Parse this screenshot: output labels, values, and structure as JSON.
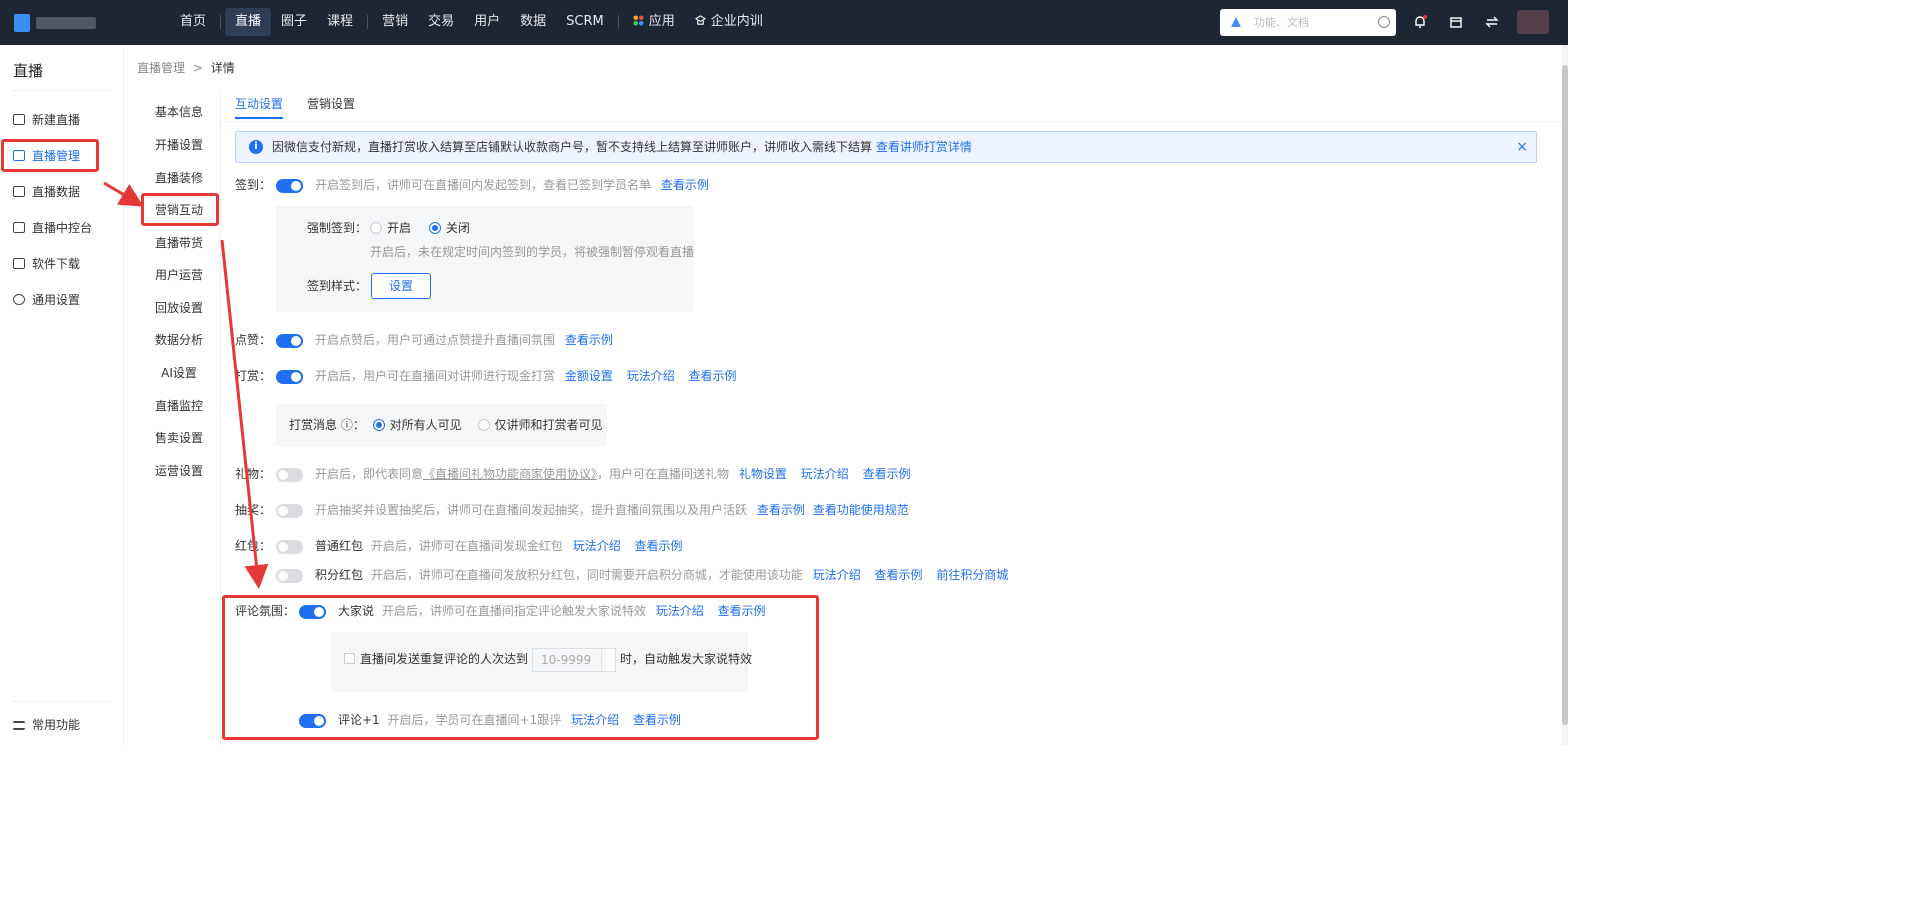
{
  "topnav": {
    "items": [
      "首页",
      "直播",
      "圈子",
      "课程",
      "营销",
      "交易",
      "用户",
      "数据",
      "SCRM",
      "应用",
      "企业内训"
    ],
    "active": "直播",
    "search_placeholder": "功能、文档"
  },
  "sidebar": {
    "title": "直播",
    "items": [
      {
        "label": "新建直播",
        "icon": "plus-box-icon"
      },
      {
        "label": "直播管理",
        "icon": "list-box-icon",
        "active": true
      },
      {
        "label": "直播数据",
        "icon": "chart-box-icon"
      },
      {
        "label": "直播中控台",
        "icon": "monitor-icon"
      },
      {
        "label": "软件下载",
        "icon": "download-icon"
      },
      {
        "label": "通用设置",
        "icon": "gear-icon"
      }
    ],
    "bottom": "常用功能"
  },
  "breadcrumb": {
    "parent": "直播管理",
    "sep": ">",
    "current": "详情"
  },
  "subnav": [
    "基本信息",
    "开播设置",
    "直播装修",
    "营销互动",
    "直播带货",
    "用户运营",
    "回放设置",
    "数据分析",
    "AI设置",
    "直播监控",
    "售卖设置",
    "运营设置"
  ],
  "tabs": [
    "互动设置",
    "营销设置"
  ],
  "notice": {
    "text": "因微信支付新规，直播打赏收入结算至店铺默认收款商户号，暂不支持线上结算至讲师账户，讲师收入需线下结算",
    "link": "查看讲师打赏详情",
    "close": "×"
  },
  "signin": {
    "label": "签到：",
    "on": true,
    "desc": "开启签到后，讲师可在直播间内发起签到，查看已签到学员名单",
    "link": "查看示例",
    "force_label": "强制签到：",
    "opt_on": "开启",
    "opt_off": "关闭",
    "force_selected": "关闭",
    "force_desc": "开启后，未在规定时间内签到的学员，将被强制暂停观看直播",
    "style_label": "签到样式：",
    "style_btn": "设置"
  },
  "like": {
    "label": "点赞：",
    "on": true,
    "desc": "开启点赞后，用户可通过点赞提升直播间氛围",
    "link": "查看示例"
  },
  "reward": {
    "label": "打赏：",
    "on": true,
    "desc": "开启后，用户可在直播间对讲师进行现金打赏",
    "links": [
      "金额设置",
      "玩法介绍",
      "查看示例"
    ],
    "msg_label": "打赏消息 ⓘ：",
    "opt_all": "对所有人可见",
    "opt_limited": "仅讲师和打赏者可见",
    "selected": "对所有人可见"
  },
  "gift": {
    "label": "礼物：",
    "on": false,
    "desc_pre": "开启后，即代表同意",
    "desc_agreement": "《直播间礼物功能商家使用协议》",
    "desc_post": "，用户可在直播间送礼物",
    "links": [
      "礼物设置",
      "玩法介绍",
      "查看示例"
    ]
  },
  "lottery": {
    "label": "抽奖：",
    "on": false,
    "desc": "开启抽奖并设置抽奖后，讲师可在直播间发起抽奖，提升直播间氛围以及用户活跃",
    "links": [
      "查看示例",
      "查看功能使用规范"
    ]
  },
  "redpacket": {
    "label": "红包：",
    "normal": {
      "name": "普通红包",
      "on": false,
      "desc": "开启后，讲师可在直播间发现金红包",
      "links": [
        "玩法介绍",
        "查看示例"
      ]
    },
    "points": {
      "name": "积分红包",
      "on": false,
      "desc": "开启后，讲师可在直播间发放积分红包，同时需要开启积分商城，才能使用该功能",
      "links": [
        "玩法介绍",
        "查看示例",
        "前往积分商城"
      ]
    }
  },
  "comment": {
    "label": "评论氛围：",
    "everyone": {
      "name": "大家说",
      "on": true,
      "desc": "开启后，讲师可在直播间指定评论触发大家说特效",
      "links": [
        "玩法介绍",
        "查看示例"
      ]
    },
    "repeat_pre": "直播间发送重复评论的人次达到",
    "repeat_placeholder": "10-9999",
    "repeat_post": "时，自动触发大家说特效",
    "plus1": {
      "name": "评论+1",
      "on": true,
      "desc": "开启后，学员可在直播间+1跟评",
      "links": [
        "玩法介绍",
        "查看示例"
      ]
    }
  },
  "colors": {
    "primary": "#1f6ff0",
    "topbar": "#1f2633",
    "annotation": "#e53935"
  }
}
